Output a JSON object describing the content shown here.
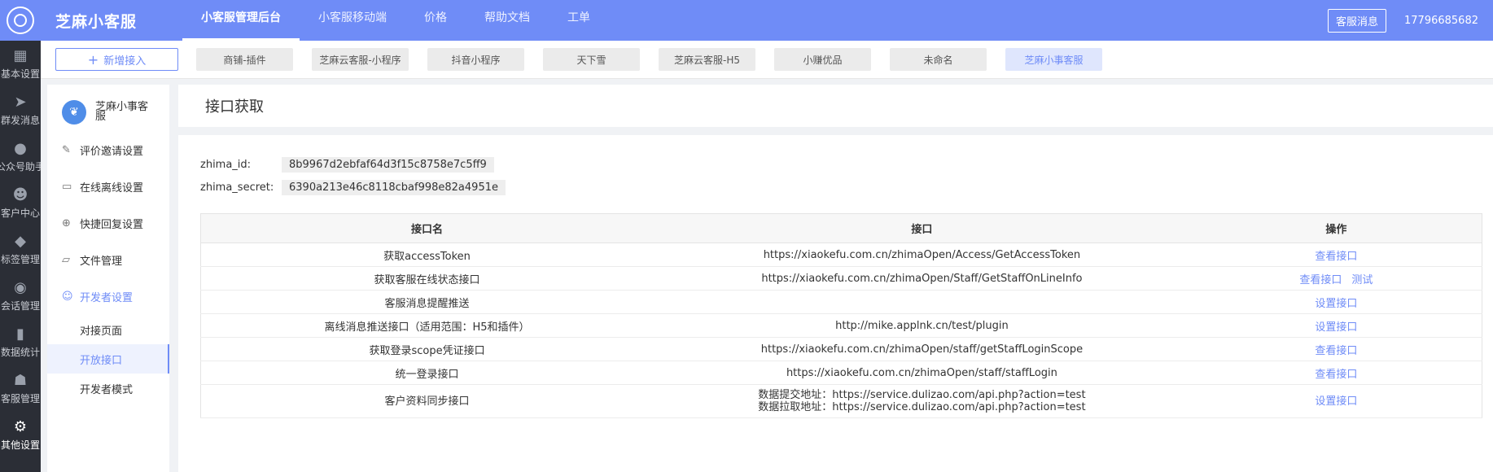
{
  "leftbar": {
    "items": [
      {
        "label": "基本设置",
        "icon": "grid-icon"
      },
      {
        "label": "群发消息",
        "icon": "send-icon"
      },
      {
        "label": "公众号助手",
        "icon": "wechat-icon"
      },
      {
        "label": "客户中心",
        "icon": "users-icon"
      },
      {
        "label": "标签管理",
        "icon": "tag-icon"
      },
      {
        "label": "会话管理",
        "icon": "chat-icon"
      },
      {
        "label": "数据统计",
        "icon": "bar-chart-icon"
      },
      {
        "label": "客服管理",
        "icon": "robot-icon"
      },
      {
        "label": "其他设置",
        "icon": "gear-icon"
      }
    ]
  },
  "header": {
    "brand": "芝麻小客服",
    "nav": [
      "小客服管理后台",
      "小客服移动端",
      "价格",
      "帮助文档",
      "工单"
    ],
    "message_button": "客服消息",
    "phone": "17796685682"
  },
  "tabs": {
    "add_label": "新增接入",
    "items": [
      "商铺-插件",
      "芝麻云客服-小程序",
      "抖音小程序",
      "天下雪",
      "芝麻云客服-H5",
      "小赚优品",
      "未命名",
      "芝麻小事客服"
    ]
  },
  "subside": {
    "name": "芝麻小事客服",
    "menu": [
      "评价邀请设置",
      "在线离线设置",
      "快捷回复设置",
      "文件管理",
      "开发者设置"
    ],
    "submenu": [
      "对接页面",
      "开放接口",
      "开发者模式"
    ]
  },
  "main": {
    "title": "接口获取",
    "id_label": "zhima_id:",
    "id_value": "8b9967d2ebfaf64d3f15c8758e7c5ff9",
    "secret_label": "zhima_secret:",
    "secret_value": "6390a213e46c8118cbaf998e82a4951e",
    "table": {
      "headers": [
        "接口名",
        "接口",
        "操作"
      ],
      "rows": [
        {
          "name": "获取accessToken",
          "url": "https://xiaokefu.com.cn/zhimaOpen/Access/GetAccessToken",
          "url2": "",
          "actions": [
            "查看接口"
          ]
        },
        {
          "name": "获取客服在线状态接口",
          "url": "https://xiaokefu.com.cn/zhimaOpen/Staff/GetStaffOnLineInfo",
          "url2": "",
          "actions": [
            "查看接口",
            "测试"
          ]
        },
        {
          "name": "客服消息提醒推送",
          "url": "",
          "url2": "",
          "actions": [
            "设置接口"
          ]
        },
        {
          "name": "离线消息推送接口（适用范围：H5和插件）",
          "url": "http://mike.applnk.cn/test/plugin",
          "url2": "",
          "actions": [
            "设置接口"
          ]
        },
        {
          "name": "获取登录scope凭证接口",
          "url": "https://xiaokefu.com.cn/zhimaOpen/staff/getStaffLoginScope",
          "url2": "",
          "actions": [
            "查看接口"
          ]
        },
        {
          "name": "统一登录接口",
          "url": "https://xiaokefu.com.cn/zhimaOpen/staff/staffLogin",
          "url2": "",
          "actions": [
            "查看接口"
          ]
        },
        {
          "name": "客户资料同步接口",
          "url": "数据提交地址：https://service.dulizao.com/api.php?action=test",
          "url2": "数据拉取地址：https://service.dulizao.com/api.php?action=test",
          "actions": [
            "设置接口"
          ]
        }
      ]
    }
  },
  "colors": {
    "accent": "#6f8cf7",
    "sidebar": "#2b2e36"
  }
}
